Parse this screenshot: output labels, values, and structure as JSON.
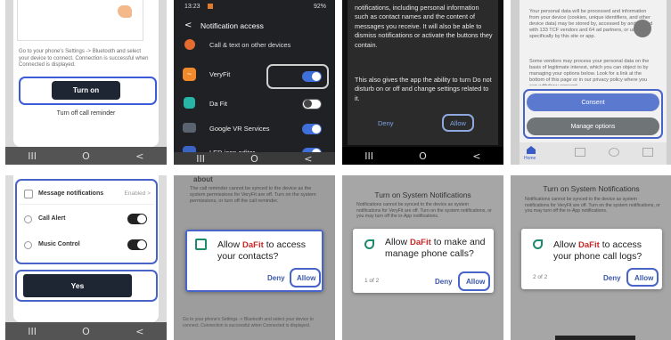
{
  "panel1": {
    "instructions": "Go to your phone's Settings -> Bluetooth and select your device to connect. Connection is successful when Connected is displayed.",
    "turn_on": "Turn on",
    "turn_off_reminder": "Turn off call reminder",
    "nav": {
      "recent": "III",
      "home": "O",
      "back": "<"
    }
  },
  "panel2": {
    "status_time": "13:23",
    "status_right": "92%",
    "title": "Notification access",
    "apps": [
      {
        "name": "Call & text on other devices",
        "toggle": "on"
      },
      {
        "name": "VeryFit",
        "toggle": "on"
      },
      {
        "name": "Da Fit",
        "toggle": "off"
      },
      {
        "name": "Google VR Services",
        "toggle": "on"
      },
      {
        "name": "LED icon editor",
        "toggle": "on"
      }
    ],
    "nav": {
      "recent": "III",
      "home": "O",
      "back": "<"
    }
  },
  "panel3": {
    "text1": "notifications, including personal information such as contact names and the content of messages you receive. It will also be able to dismiss notifications or activate the buttons they contain.",
    "text2": "This also gives the app the ability to turn Do not disturb on or off and change settings related to it.",
    "deny": "Deny",
    "allow": "Allow",
    "nav": {
      "recent": "III",
      "home": "O",
      "back": "<"
    }
  },
  "panel4": {
    "text1": "Your personal data will be processed and information from your device (cookies, unique identifiers, and other device data) may be stored by, accessed by and shared with 133 TCF vendors and 64 ad partners, or used specifically by this site or app.",
    "text2": "Some vendors may process your personal data on the basis of legitimate interest, which you can object to by managing your options below. Look for a link at the bottom of this page or in our privacy policy where you can withdraw consent.",
    "consent": "Consent",
    "manage": "Manage options",
    "tab_home": "Home"
  },
  "panel5": {
    "rows": [
      {
        "label": "Message notifications",
        "value": "Enabled >"
      },
      {
        "label": "Call Alert",
        "toggle": "on"
      },
      {
        "label": "Music Control",
        "toggle": "on"
      }
    ],
    "yes": "Yes",
    "nav": {
      "recent": "III",
      "home": "O",
      "back": "<"
    }
  },
  "panel6": {
    "header": "about",
    "note": "The call reminder cannot be synced to the device as the system permissions for VeryFit are off. Turn on the system permissions, or turn off the call reminder.",
    "allow_prefix": "Allow",
    "brand": "DaFit",
    "allow_suffix": "to access your contacts?",
    "deny": "Deny",
    "allow": "Allow",
    "footer": "Go to your phone's Settings -> Bluetooth and select your device to connect. Connection is successful when Connected is displayed."
  },
  "panel7": {
    "title": "Turn on System Notifications",
    "note": "Notifications cannot be synced to the device as system notifications for VeryFit are off. Turn on the system notifications, or you may turn off the in-App notifications.",
    "allow_prefix": "Allow",
    "brand": "DaFit",
    "allow_suffix": "to make and manage phone calls?",
    "counter": "1 of 2",
    "deny": "Deny",
    "allow": "Allow"
  },
  "panel8": {
    "title": "Turn on System Notifications",
    "note": "Notifications cannot be synced to the device as system notifications for VeryFit are off. Turn on the system notifications, or you may turn off the in-App notifications.",
    "allow_prefix": "Allow",
    "brand": "DaFit",
    "allow_suffix": "to access your phone call logs?",
    "counter": "2 of 2",
    "deny": "Deny",
    "allow": "Allow"
  }
}
